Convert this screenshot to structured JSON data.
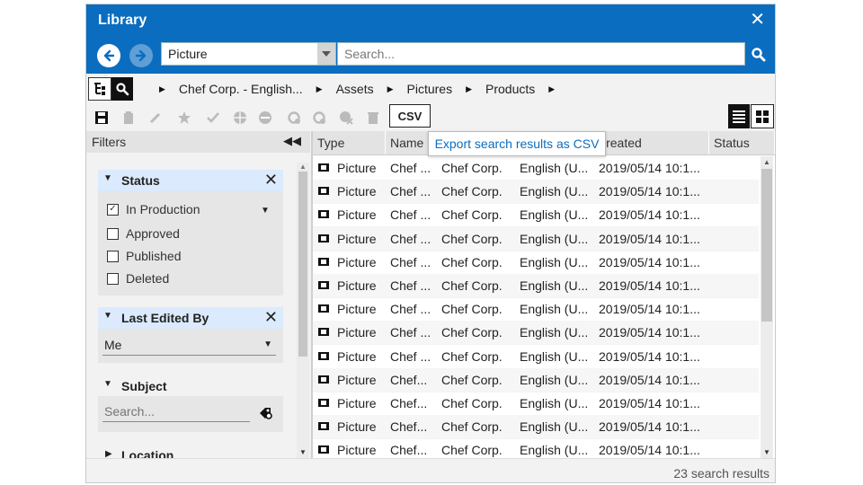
{
  "window": {
    "title": "Library",
    "close": "✕"
  },
  "search": {
    "type_value": "Picture",
    "placeholder": "Search..."
  },
  "breadcrumb": [
    "Chef Corp. - English...",
    "Assets",
    "Pictures",
    "Products"
  ],
  "toolbar": {
    "csv_label": "CSV",
    "tooltip": "Export search results as CSV"
  },
  "filters": {
    "header": "Filters",
    "status": {
      "title": "Status",
      "options": [
        {
          "label": "In Production",
          "checked": true
        },
        {
          "label": "Approved",
          "checked": false
        },
        {
          "label": "Published",
          "checked": false
        },
        {
          "label": "Deleted",
          "checked": false
        }
      ]
    },
    "last_edited_by": {
      "title": "Last Edited By",
      "value": "Me"
    },
    "subject": {
      "title": "Subject",
      "placeholder": "Search..."
    },
    "location": {
      "title": "Location"
    }
  },
  "grid": {
    "columns": [
      "Type",
      "Name",
      "",
      "",
      "Created",
      "Status"
    ],
    "rows": [
      [
        "Picture",
        "Chef ...",
        "Chef Corp.",
        "English (U...",
        "2019/05/14 10:1...",
        ""
      ],
      [
        "Picture",
        "Chef ...",
        "Chef Corp.",
        "English (U...",
        "2019/05/14 10:1...",
        ""
      ],
      [
        "Picture",
        "Chef ...",
        "Chef Corp.",
        "English (U...",
        "2019/05/14 10:1...",
        ""
      ],
      [
        "Picture",
        "Chef ...",
        "Chef Corp.",
        "English (U...",
        "2019/05/14 10:1...",
        ""
      ],
      [
        "Picture",
        "Chef ...",
        "Chef Corp.",
        "English (U...",
        "2019/05/14 10:1...",
        ""
      ],
      [
        "Picture",
        "Chef ...",
        "Chef Corp.",
        "English (U...",
        "2019/05/14 10:1...",
        ""
      ],
      [
        "Picture",
        "Chef ...",
        "Chef Corp.",
        "English (U...",
        "2019/05/14 10:1...",
        ""
      ],
      [
        "Picture",
        "Chef ...",
        "Chef Corp.",
        "English (U...",
        "2019/05/14 10:1...",
        ""
      ],
      [
        "Picture",
        "Chef ...",
        "Chef Corp.",
        "English (U...",
        "2019/05/14 10:1...",
        ""
      ],
      [
        "Picture",
        "Chef...",
        "Chef Corp.",
        "English (U...",
        "2019/05/14 10:1...",
        ""
      ],
      [
        "Picture",
        "Chef...",
        "Chef Corp.",
        "English (U...",
        "2019/05/14 10:1...",
        ""
      ],
      [
        "Picture",
        "Chef...",
        "Chef Corp.",
        "English (U...",
        "2019/05/14 10:1...",
        ""
      ],
      [
        "Picture",
        "Chef...",
        "Chef Corp.",
        "English (U...",
        "2019/05/14 10:1...",
        ""
      ]
    ]
  },
  "status": {
    "results": "23 search results"
  },
  "colors": {
    "header_blue": "#0b6dbf",
    "filter_head": "#dbeafc",
    "link_blue": "#0b6dbf"
  }
}
